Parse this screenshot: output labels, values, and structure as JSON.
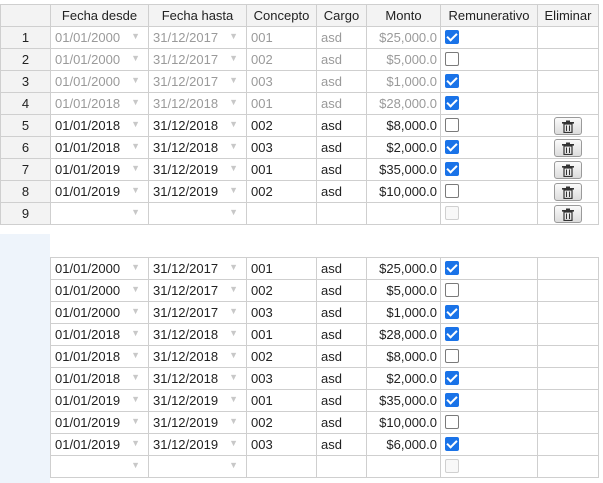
{
  "columns": {
    "fecha_desde": "Fecha desde",
    "fecha_hasta": "Fecha hasta",
    "concepto": "Concepto",
    "cargo": "Cargo",
    "monto": "Monto",
    "remunerativo": "Remunerativo",
    "eliminar": "Eliminar"
  },
  "table1": [
    {
      "n": "1",
      "desde": "01/01/2000",
      "hasta": "31/12/2017",
      "concepto": "001",
      "cargo": "asd",
      "monto": "$25,000.0",
      "rem": true,
      "readonly": true,
      "delete": false
    },
    {
      "n": "2",
      "desde": "01/01/2000",
      "hasta": "31/12/2017",
      "concepto": "002",
      "cargo": "asd",
      "monto": "$5,000.0",
      "rem": false,
      "readonly": true,
      "delete": false
    },
    {
      "n": "3",
      "desde": "01/01/2000",
      "hasta": "31/12/2017",
      "concepto": "003",
      "cargo": "asd",
      "monto": "$1,000.0",
      "rem": true,
      "readonly": true,
      "delete": false
    },
    {
      "n": "4",
      "desde": "01/01/2018",
      "hasta": "31/12/2018",
      "concepto": "001",
      "cargo": "asd",
      "monto": "$28,000.0",
      "rem": true,
      "readonly": true,
      "delete": false
    },
    {
      "n": "5",
      "desde": "01/01/2018",
      "hasta": "31/12/2018",
      "concepto": "002",
      "cargo": "asd",
      "monto": "$8,000.0",
      "rem": false,
      "readonly": false,
      "delete": true
    },
    {
      "n": "6",
      "desde": "01/01/2018",
      "hasta": "31/12/2018",
      "concepto": "003",
      "cargo": "asd",
      "monto": "$2,000.0",
      "rem": true,
      "readonly": false,
      "delete": true
    },
    {
      "n": "7",
      "desde": "01/01/2019",
      "hasta": "31/12/2019",
      "concepto": "001",
      "cargo": "asd",
      "monto": "$35,000.0",
      "rem": true,
      "readonly": false,
      "delete": true
    },
    {
      "n": "8",
      "desde": "01/01/2019",
      "hasta": "31/12/2019",
      "concepto": "002",
      "cargo": "asd",
      "monto": "$10,000.0",
      "rem": false,
      "readonly": false,
      "delete": true
    },
    {
      "n": "9",
      "desde": "",
      "hasta": "",
      "concepto": "",
      "cargo": "",
      "monto": "",
      "rem": null,
      "readonly": false,
      "delete": true
    }
  ],
  "table2": [
    {
      "desde": "01/01/2000",
      "hasta": "31/12/2017",
      "concepto": "001",
      "cargo": "asd",
      "monto": "$25,000.0",
      "rem": true
    },
    {
      "desde": "01/01/2000",
      "hasta": "31/12/2017",
      "concepto": "002",
      "cargo": "asd",
      "monto": "$5,000.0",
      "rem": false
    },
    {
      "desde": "01/01/2000",
      "hasta": "31/12/2017",
      "concepto": "003",
      "cargo": "asd",
      "monto": "$1,000.0",
      "rem": true
    },
    {
      "desde": "01/01/2018",
      "hasta": "31/12/2018",
      "concepto": "001",
      "cargo": "asd",
      "monto": "$28,000.0",
      "rem": true
    },
    {
      "desde": "01/01/2018",
      "hasta": "31/12/2018",
      "concepto": "002",
      "cargo": "asd",
      "monto": "$8,000.0",
      "rem": false
    },
    {
      "desde": "01/01/2018",
      "hasta": "31/12/2018",
      "concepto": "003",
      "cargo": "asd",
      "monto": "$2,000.0",
      "rem": true
    },
    {
      "desde": "01/01/2019",
      "hasta": "31/12/2019",
      "concepto": "001",
      "cargo": "asd",
      "monto": "$35,000.0",
      "rem": true
    },
    {
      "desde": "01/01/2019",
      "hasta": "31/12/2019",
      "concepto": "002",
      "cargo": "asd",
      "monto": "$10,000.0",
      "rem": false
    },
    {
      "desde": "01/01/2019",
      "hasta": "31/12/2019",
      "concepto": "003",
      "cargo": "asd",
      "monto": "$6,000.0",
      "rem": true
    },
    {
      "desde": "",
      "hasta": "",
      "concepto": "",
      "cargo": "",
      "monto": "",
      "rem": null
    }
  ],
  "icons": {
    "dropdown": "chevron-down-icon",
    "delete": "trash-icon",
    "checkbox": "checkbox-icon"
  },
  "colors": {
    "accent": "#1a73e8",
    "header_bg": "#f3f3f3",
    "readonly_text": "#9a9a9a",
    "gap_bg": "#eef4fb"
  }
}
